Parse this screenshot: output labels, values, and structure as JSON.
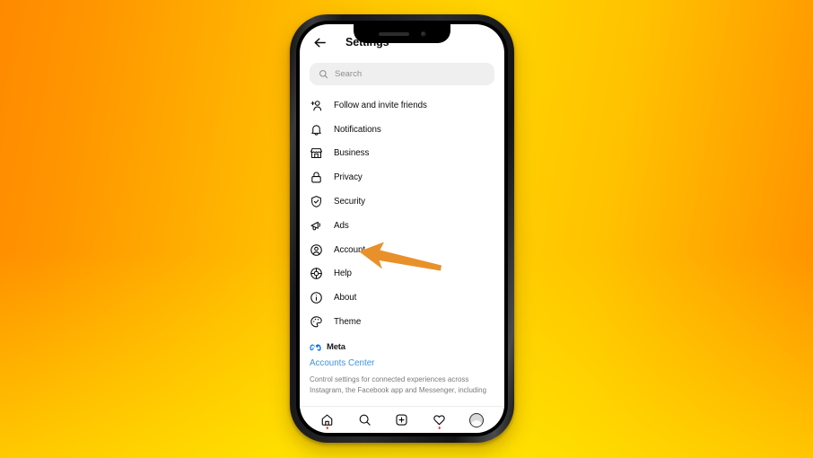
{
  "background": {
    "gradient_start": "#ff8a00",
    "gradient_mid": "#ffd400",
    "gradient_end": "#ff8c00"
  },
  "device": {
    "frame_color": "#17171a",
    "notch": {
      "speaker": "speaker-grille",
      "camera": "front-camera"
    }
  },
  "header": {
    "back_icon": "arrow-left-icon",
    "title": "Settings"
  },
  "search": {
    "icon": "search-icon",
    "placeholder": "Search",
    "value": "",
    "background": "#efefef"
  },
  "menu": {
    "items": [
      {
        "label": "Follow and invite friends",
        "icon": "person-add-icon"
      },
      {
        "label": "Notifications",
        "icon": "bell-icon"
      },
      {
        "label": "Business",
        "icon": "storefront-icon"
      },
      {
        "label": "Privacy",
        "icon": "lock-icon"
      },
      {
        "label": "Security",
        "icon": "shield-check-icon"
      },
      {
        "label": "Ads",
        "icon": "megaphone-icon"
      },
      {
        "label": "Account",
        "icon": "person-circle-icon"
      },
      {
        "label": "Help",
        "icon": "lifebuoy-icon"
      },
      {
        "label": "About",
        "icon": "info-circle-icon"
      },
      {
        "label": "Theme",
        "icon": "palette-icon"
      }
    ]
  },
  "meta_section": {
    "logo_icon": "meta-infinity-logo",
    "brand": "Meta",
    "link_label": "Accounts Center",
    "link_color": "#3f93e0",
    "description": "Control settings for connected experiences across Instagram, the Facebook app and Messenger, including"
  },
  "bottom_nav": {
    "items": [
      {
        "icon": "home-icon",
        "badge": true
      },
      {
        "icon": "search-icon",
        "badge": false
      },
      {
        "icon": "add-post-icon",
        "badge": false
      },
      {
        "icon": "heart-icon",
        "badge": true
      },
      {
        "icon": "profile-avatar-icon",
        "badge": false
      }
    ]
  },
  "annotation": {
    "icon": "arrow-pointing-left",
    "color": "#E8912A",
    "points_to": "Account"
  }
}
